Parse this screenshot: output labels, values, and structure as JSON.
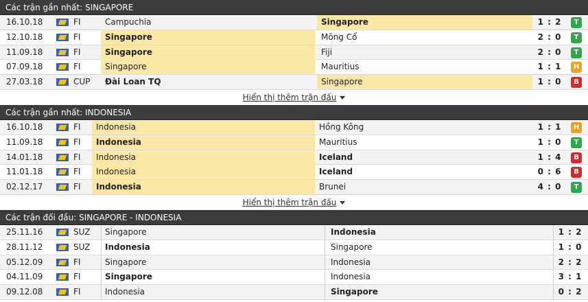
{
  "section1": {
    "title": "Các trận gần nhất: SINGAPORE",
    "rows": [
      {
        "date": "16.10.18",
        "comp": "FI",
        "home": "Campuchia",
        "away": "Singapore",
        "score": "1 : 2",
        "result": "T",
        "home_bold": false,
        "away_bold": true,
        "home_hl": false,
        "away_hl": true
      },
      {
        "date": "12.10.18",
        "comp": "FI",
        "home": "Singapore",
        "away": "Mông Cổ",
        "score": "2 : 0",
        "result": "T",
        "home_bold": true,
        "away_bold": false,
        "home_hl": true,
        "away_hl": false
      },
      {
        "date": "11.09.18",
        "comp": "FI",
        "home": "Singapore",
        "away": "Fiji",
        "score": "2 : 0",
        "result": "T",
        "home_bold": true,
        "away_bold": false,
        "home_hl": true,
        "away_hl": false
      },
      {
        "date": "07.09.18",
        "comp": "FI",
        "home": "Singapore",
        "away": "Mauritius",
        "score": "1 : 1",
        "result": "H",
        "home_bold": false,
        "away_bold": false,
        "home_hl": true,
        "away_hl": false
      },
      {
        "date": "27.03.18",
        "comp": "CUP",
        "home": "Đài Loan TQ",
        "away": "Singapore",
        "score": "1 : 0",
        "result": "B",
        "home_bold": true,
        "away_bold": false,
        "home_hl": false,
        "away_hl": true
      }
    ],
    "more_label": "Hiển thị thêm trận đấu"
  },
  "section2": {
    "title": "Các trận gần nhất: INDONESIA",
    "rows": [
      {
        "date": "16.10.18",
        "comp": "FI",
        "home": "Indonesia",
        "away": "Hồng Kông",
        "score": "1 : 1",
        "result": "H",
        "home_bold": false,
        "away_bold": false,
        "home_hl": true,
        "away_hl": false
      },
      {
        "date": "11.09.18",
        "comp": "FI",
        "home": "Indonesia",
        "away": "Mauritius",
        "score": "1 : 0",
        "result": "T",
        "home_bold": true,
        "away_bold": false,
        "home_hl": true,
        "away_hl": false
      },
      {
        "date": "14.01.18",
        "comp": "FI",
        "home": "Indonesia",
        "away": "Iceland",
        "score": "1 : 4",
        "result": "B",
        "home_bold": false,
        "away_bold": true,
        "home_hl": true,
        "away_hl": false
      },
      {
        "date": "11.01.18",
        "comp": "FI",
        "home": "Indonesia",
        "away": "Iceland",
        "score": "0 : 6",
        "result": "B",
        "home_bold": false,
        "away_bold": true,
        "home_hl": true,
        "away_hl": false
      },
      {
        "date": "02.12.17",
        "comp": "FI",
        "home": "Indonesia",
        "away": "Brunei",
        "score": "4 : 0",
        "result": "T",
        "home_bold": true,
        "away_bold": false,
        "home_hl": true,
        "away_hl": false
      }
    ],
    "more_label": "Hiển thị thêm trận đấu"
  },
  "section3": {
    "title": "Các trận đối đầu: SINGAPORE - INDONESIA",
    "rows": [
      {
        "date": "25.11.16",
        "comp": "SUZ",
        "home": "Singapore",
        "away": "Indonesia",
        "score": "1 : 2",
        "home_bold": false,
        "away_bold": true
      },
      {
        "date": "28.11.12",
        "comp": "SUZ",
        "home": "Indonesia",
        "away": "Singapore",
        "score": "1 : 0",
        "home_bold": true,
        "away_bold": false
      },
      {
        "date": "05.12.09",
        "comp": "FI",
        "home": "Singapore",
        "away": "Indonesia",
        "score": "2 : 2",
        "home_bold": false,
        "away_bold": false
      },
      {
        "date": "04.11.09",
        "comp": "FI",
        "home": "Singapore",
        "away": "Indonesia",
        "score": "3 : 1",
        "home_bold": true,
        "away_bold": false
      },
      {
        "date": "09.12.08",
        "comp": "FI",
        "home": "Indonesia",
        "away": "Singapore",
        "score": "0 : 2",
        "home_bold": false,
        "away_bold": true
      }
    ]
  },
  "colors": {
    "header_bg": "#3c3c3c",
    "highlight": "#fbe8a6",
    "win": "#2fa84a",
    "draw": "#f0a020",
    "loss": "#d42b2b"
  },
  "icons": {
    "flag": "competition-flag-icon",
    "caret": "caret-down-icon"
  }
}
